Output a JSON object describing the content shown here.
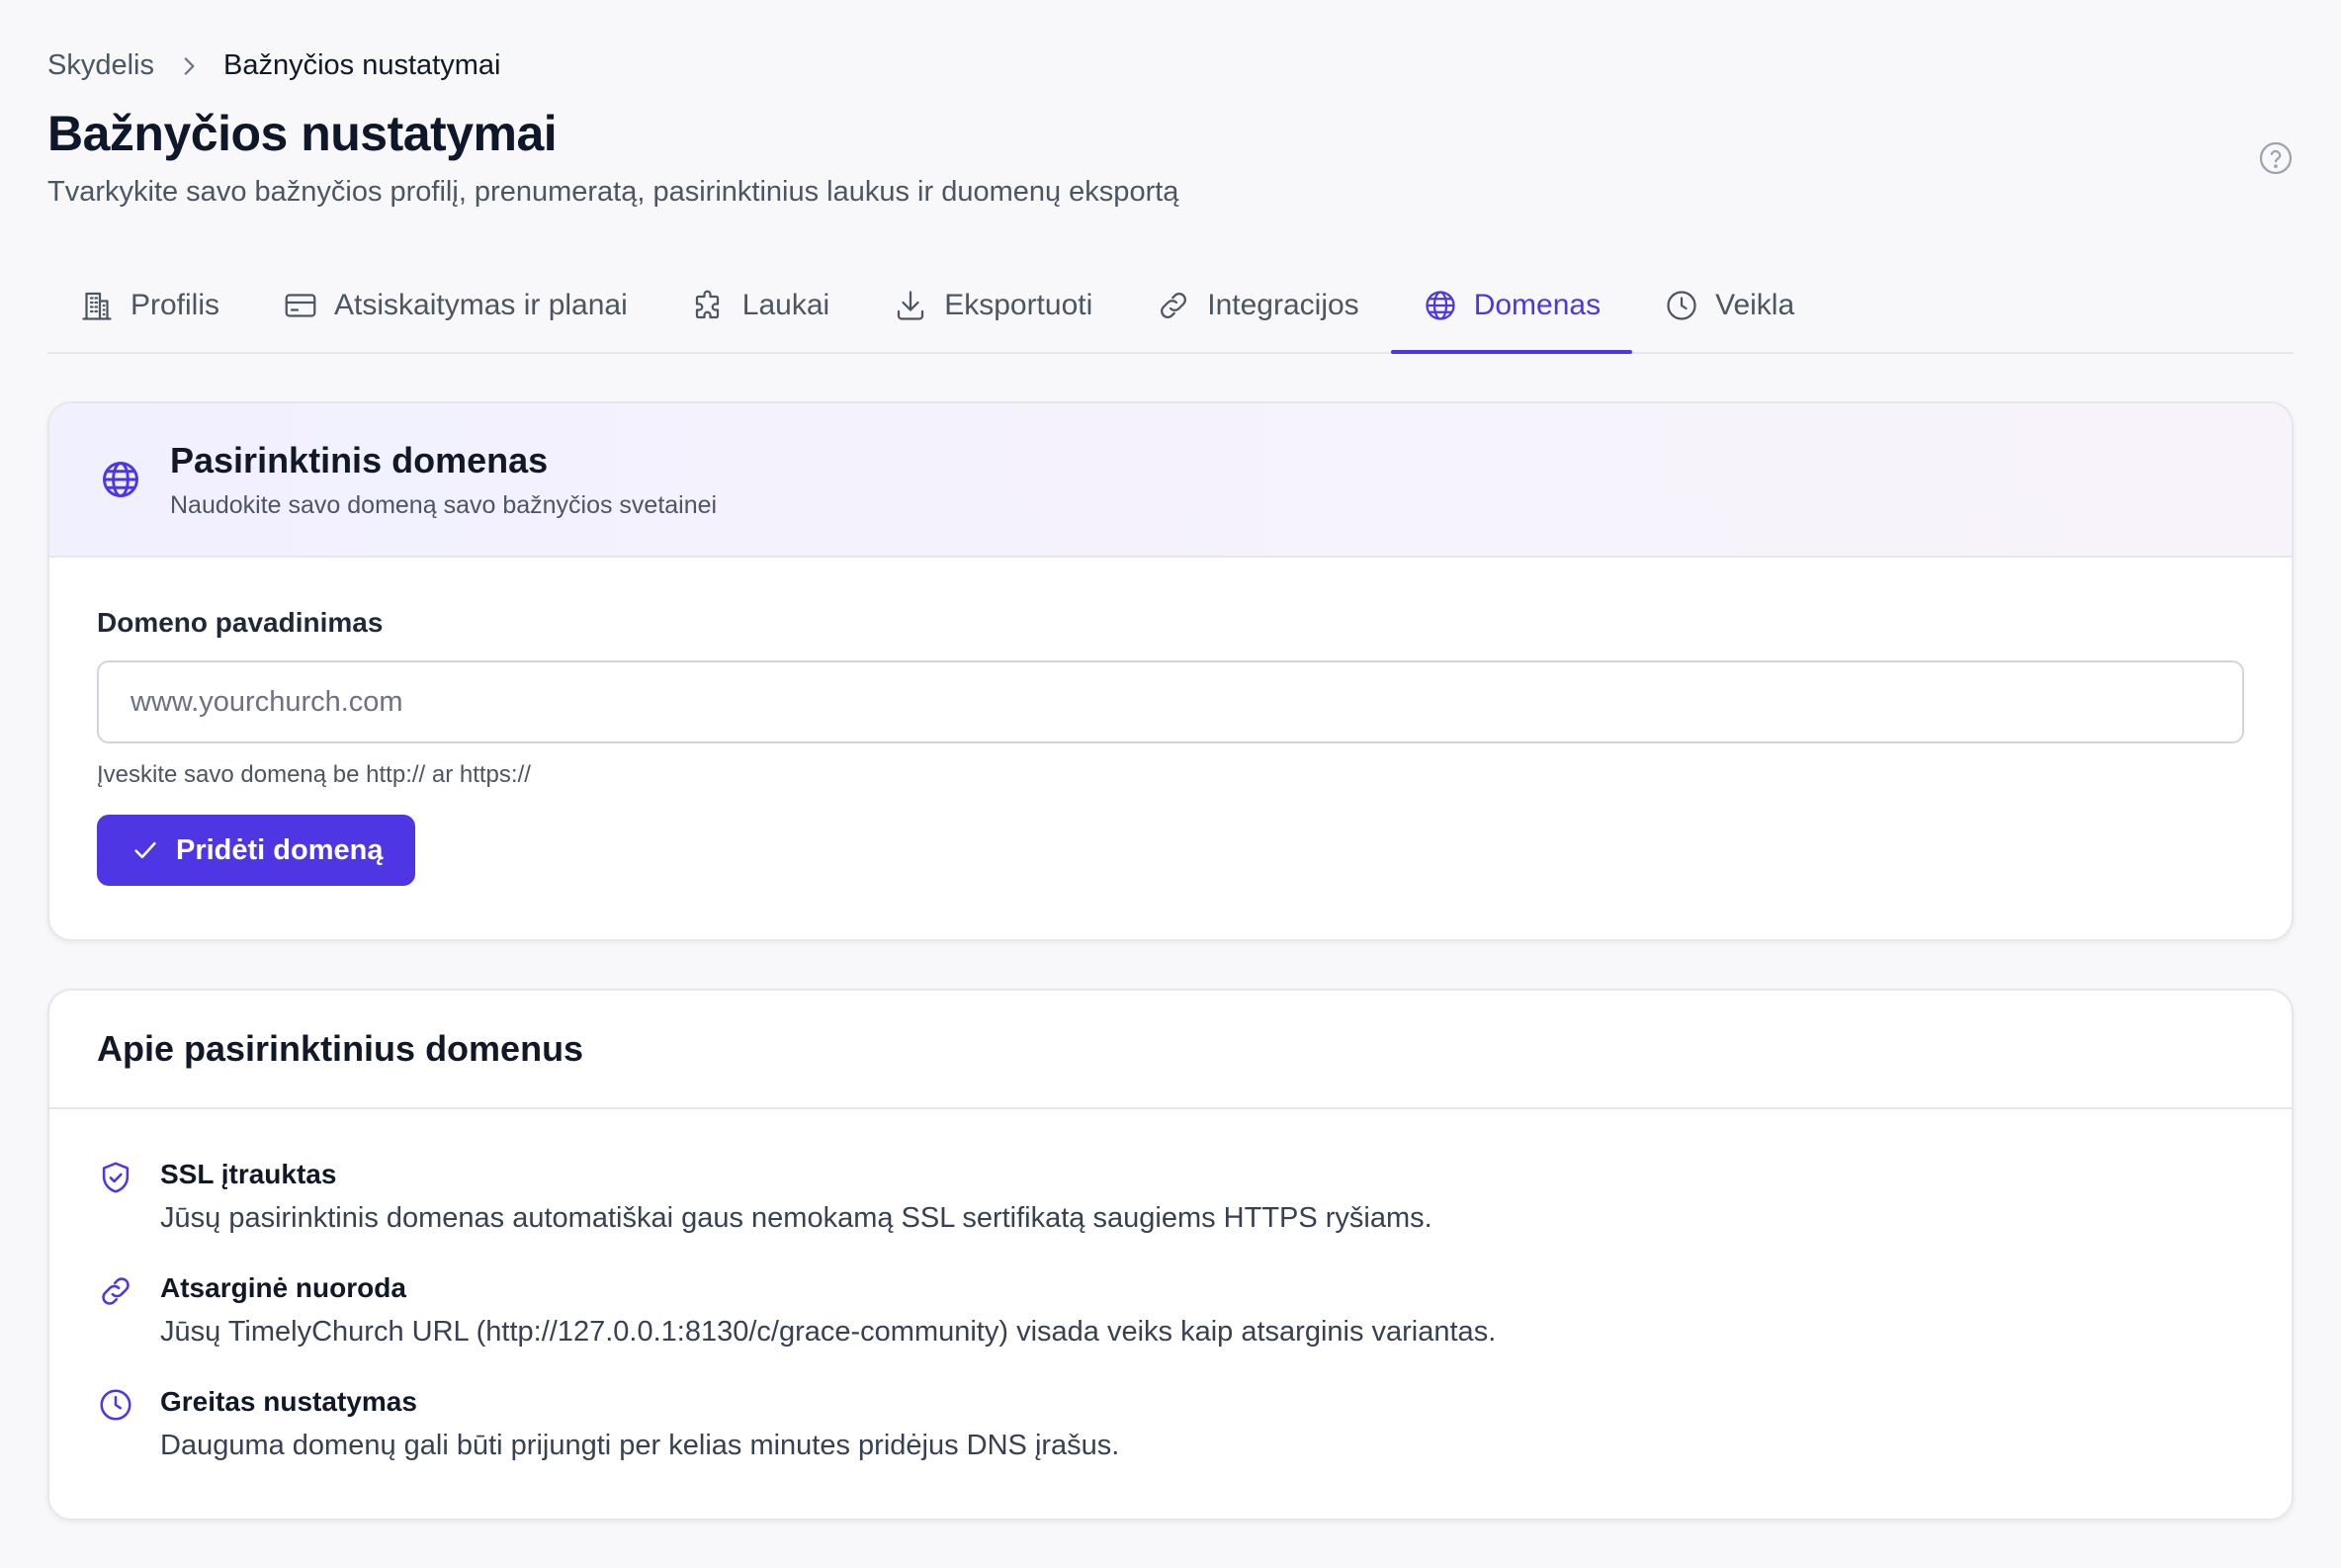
{
  "breadcrumb": {
    "parent": "Skydelis",
    "current": "Bažnyčios nustatymai"
  },
  "header": {
    "title": "Bažnyčios nustatymai",
    "subtitle": "Tvarkykite savo bažnyčios profilį, prenumeratą, pasirinktinius laukus ir duomenų eksportą"
  },
  "tabs": [
    {
      "label": "Profilis",
      "icon": "building-icon",
      "active": false
    },
    {
      "label": "Atsiskaitymas ir planai",
      "icon": "credit-card-icon",
      "active": false
    },
    {
      "label": "Laukai",
      "icon": "puzzle-icon",
      "active": false
    },
    {
      "label": "Eksportuoti",
      "icon": "download-icon",
      "active": false
    },
    {
      "label": "Integracijos",
      "icon": "link-icon",
      "active": false
    },
    {
      "label": "Domenas",
      "icon": "globe-icon",
      "active": true
    },
    {
      "label": "Veikla",
      "icon": "clock-icon",
      "active": false
    }
  ],
  "domain_card": {
    "title": "Pasirinktinis domenas",
    "description": "Naudokite savo domeną savo bažnyčios svetainei",
    "field_label": "Domeno pavadinimas",
    "input_value": "",
    "input_placeholder": "www.yourchurch.com",
    "hint": "Įveskite savo domeną be http:// ar https://",
    "button_label": "Pridėti domeną"
  },
  "about_card": {
    "title": "Apie pasirinktinius domenus",
    "features": [
      {
        "icon": "shield-check-icon",
        "title": "SSL įtrauktas",
        "description": "Jūsų pasirinktinis domenas automatiškai gaus nemokamą SSL sertifikatą saugiems HTTPS ryšiams."
      },
      {
        "icon": "link-icon",
        "title": "Atsarginė nuoroda",
        "description": "Jūsų TimelyChurch URL (http://127.0.0.1:8130/c/grace-community) visada veiks kaip atsarginis variantas."
      },
      {
        "icon": "clock-icon",
        "title": "Greitas nustatymas",
        "description": "Dauguma domenų gali būti prijungti per kelias minutes pridėjus DNS įrašus."
      }
    ]
  },
  "colors": {
    "accent": "#4f36e5",
    "text_primary": "#111827",
    "text_secondary": "#4b5563",
    "border": "#e5e7eb",
    "background": "#f8f8fa"
  }
}
